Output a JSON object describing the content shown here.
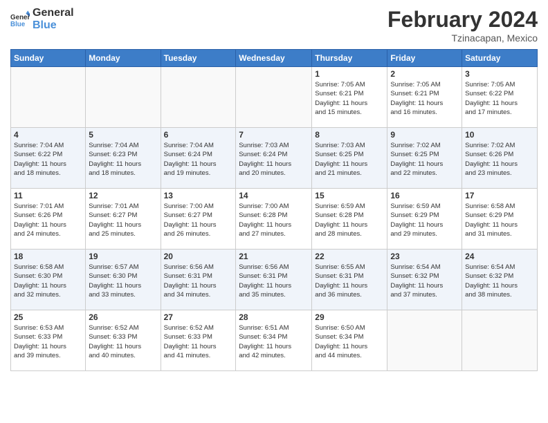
{
  "logo": {
    "text_general": "General",
    "text_blue": "Blue"
  },
  "header": {
    "month_year": "February 2024",
    "location": "Tzinacapan, Mexico"
  },
  "weekdays": [
    "Sunday",
    "Monday",
    "Tuesday",
    "Wednesday",
    "Thursday",
    "Friday",
    "Saturday"
  ],
  "weeks": [
    [
      {
        "day": "",
        "info": ""
      },
      {
        "day": "",
        "info": ""
      },
      {
        "day": "",
        "info": ""
      },
      {
        "day": "",
        "info": ""
      },
      {
        "day": "1",
        "info": "Sunrise: 7:05 AM\nSunset: 6:21 PM\nDaylight: 11 hours\nand 15 minutes."
      },
      {
        "day": "2",
        "info": "Sunrise: 7:05 AM\nSunset: 6:21 PM\nDaylight: 11 hours\nand 16 minutes."
      },
      {
        "day": "3",
        "info": "Sunrise: 7:05 AM\nSunset: 6:22 PM\nDaylight: 11 hours\nand 17 minutes."
      }
    ],
    [
      {
        "day": "4",
        "info": "Sunrise: 7:04 AM\nSunset: 6:22 PM\nDaylight: 11 hours\nand 18 minutes."
      },
      {
        "day": "5",
        "info": "Sunrise: 7:04 AM\nSunset: 6:23 PM\nDaylight: 11 hours\nand 18 minutes."
      },
      {
        "day": "6",
        "info": "Sunrise: 7:04 AM\nSunset: 6:24 PM\nDaylight: 11 hours\nand 19 minutes."
      },
      {
        "day": "7",
        "info": "Sunrise: 7:03 AM\nSunset: 6:24 PM\nDaylight: 11 hours\nand 20 minutes."
      },
      {
        "day": "8",
        "info": "Sunrise: 7:03 AM\nSunset: 6:25 PM\nDaylight: 11 hours\nand 21 minutes."
      },
      {
        "day": "9",
        "info": "Sunrise: 7:02 AM\nSunset: 6:25 PM\nDaylight: 11 hours\nand 22 minutes."
      },
      {
        "day": "10",
        "info": "Sunrise: 7:02 AM\nSunset: 6:26 PM\nDaylight: 11 hours\nand 23 minutes."
      }
    ],
    [
      {
        "day": "11",
        "info": "Sunrise: 7:01 AM\nSunset: 6:26 PM\nDaylight: 11 hours\nand 24 minutes."
      },
      {
        "day": "12",
        "info": "Sunrise: 7:01 AM\nSunset: 6:27 PM\nDaylight: 11 hours\nand 25 minutes."
      },
      {
        "day": "13",
        "info": "Sunrise: 7:00 AM\nSunset: 6:27 PM\nDaylight: 11 hours\nand 26 minutes."
      },
      {
        "day": "14",
        "info": "Sunrise: 7:00 AM\nSunset: 6:28 PM\nDaylight: 11 hours\nand 27 minutes."
      },
      {
        "day": "15",
        "info": "Sunrise: 6:59 AM\nSunset: 6:28 PM\nDaylight: 11 hours\nand 28 minutes."
      },
      {
        "day": "16",
        "info": "Sunrise: 6:59 AM\nSunset: 6:29 PM\nDaylight: 11 hours\nand 29 minutes."
      },
      {
        "day": "17",
        "info": "Sunrise: 6:58 AM\nSunset: 6:29 PM\nDaylight: 11 hours\nand 31 minutes."
      }
    ],
    [
      {
        "day": "18",
        "info": "Sunrise: 6:58 AM\nSunset: 6:30 PM\nDaylight: 11 hours\nand 32 minutes."
      },
      {
        "day": "19",
        "info": "Sunrise: 6:57 AM\nSunset: 6:30 PM\nDaylight: 11 hours\nand 33 minutes."
      },
      {
        "day": "20",
        "info": "Sunrise: 6:56 AM\nSunset: 6:31 PM\nDaylight: 11 hours\nand 34 minutes."
      },
      {
        "day": "21",
        "info": "Sunrise: 6:56 AM\nSunset: 6:31 PM\nDaylight: 11 hours\nand 35 minutes."
      },
      {
        "day": "22",
        "info": "Sunrise: 6:55 AM\nSunset: 6:31 PM\nDaylight: 11 hours\nand 36 minutes."
      },
      {
        "day": "23",
        "info": "Sunrise: 6:54 AM\nSunset: 6:32 PM\nDaylight: 11 hours\nand 37 minutes."
      },
      {
        "day": "24",
        "info": "Sunrise: 6:54 AM\nSunset: 6:32 PM\nDaylight: 11 hours\nand 38 minutes."
      }
    ],
    [
      {
        "day": "25",
        "info": "Sunrise: 6:53 AM\nSunset: 6:33 PM\nDaylight: 11 hours\nand 39 minutes."
      },
      {
        "day": "26",
        "info": "Sunrise: 6:52 AM\nSunset: 6:33 PM\nDaylight: 11 hours\nand 40 minutes."
      },
      {
        "day": "27",
        "info": "Sunrise: 6:52 AM\nSunset: 6:33 PM\nDaylight: 11 hours\nand 41 minutes."
      },
      {
        "day": "28",
        "info": "Sunrise: 6:51 AM\nSunset: 6:34 PM\nDaylight: 11 hours\nand 42 minutes."
      },
      {
        "day": "29",
        "info": "Sunrise: 6:50 AM\nSunset: 6:34 PM\nDaylight: 11 hours\nand 44 minutes."
      },
      {
        "day": "",
        "info": ""
      },
      {
        "day": "",
        "info": ""
      }
    ]
  ]
}
